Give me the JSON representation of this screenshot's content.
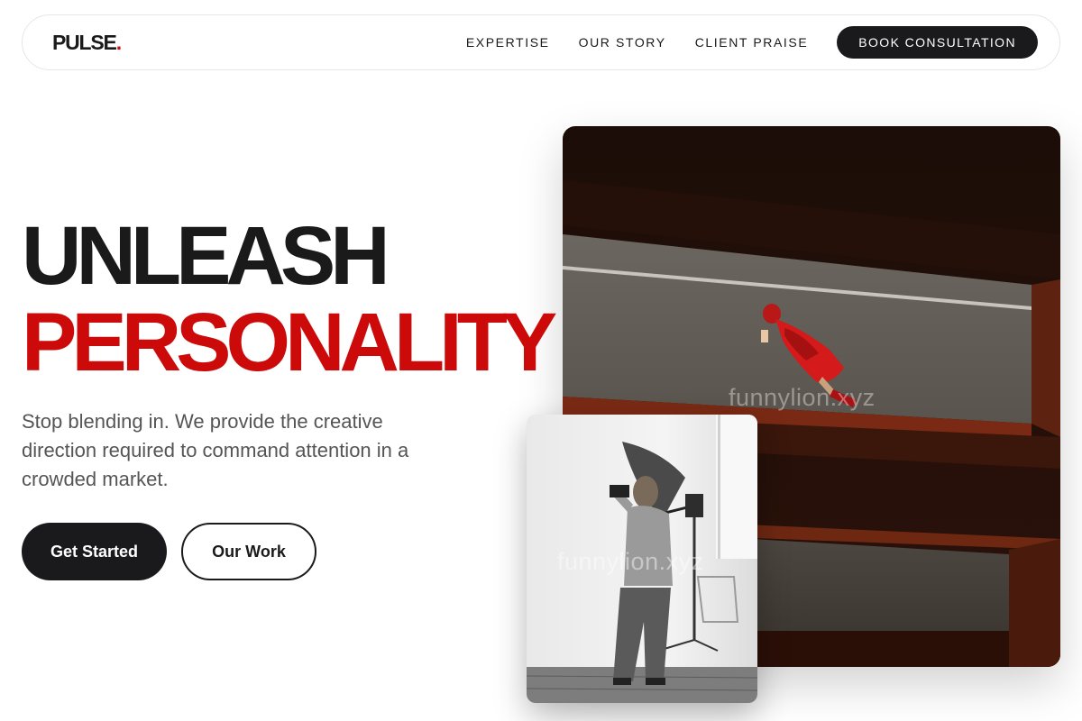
{
  "brand": {
    "name": "PULSE",
    "dot": "."
  },
  "nav": {
    "links": [
      "EXPERTISE",
      "OUR STORY",
      "CLIENT PRAISE"
    ],
    "cta": "BOOK CONSULTATION"
  },
  "hero": {
    "headline_line1": "UNLEASH",
    "headline_line2": "PERSONALITY",
    "subtext": "Stop blending in. We provide the creative direction required to command attention in a crowded market.",
    "primary_button": "Get Started",
    "secondary_button": "Our Work"
  },
  "images": {
    "watermark": "funnylion.xyz"
  },
  "colors": {
    "accent": "#cc0a0a",
    "dark": "#1a1a1c",
    "body_text": "#555555"
  }
}
